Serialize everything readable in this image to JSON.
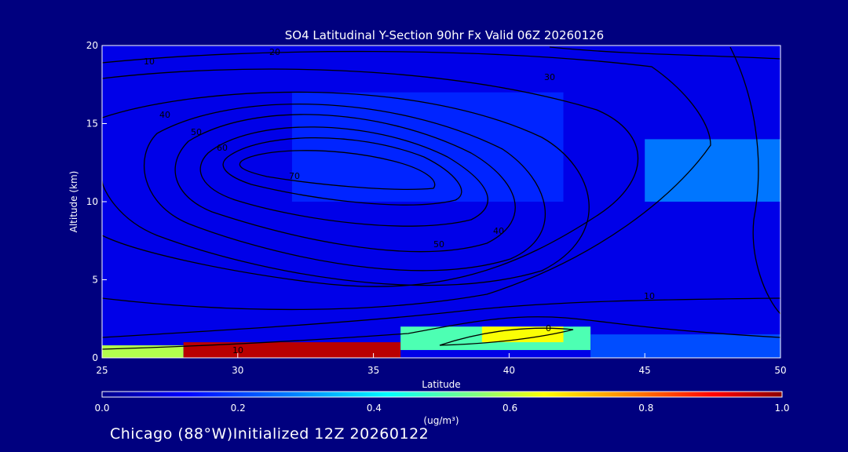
{
  "chart_data": {
    "type": "heatmap",
    "title": "SO4 Latitudinal Y-Section 90hr  Fx Valid 06Z 20260126",
    "xlabel": "Latitude",
    "ylabel": "Altitude (km)",
    "xlim": [
      25,
      50
    ],
    "ylim": [
      0,
      20
    ],
    "x_ticks": [
      25,
      30,
      35,
      40,
      45,
      50
    ],
    "y_ticks": [
      0,
      5,
      10,
      15,
      20
    ],
    "colorbar": {
      "label": "(ug/m³)",
      "min": 0.0,
      "max": 1.0,
      "ticks": [
        "0.0",
        "0.2",
        "0.4",
        "0.6",
        "0.8",
        "1.0"
      ],
      "colors": [
        "#00008b",
        "#0000ff",
        "#0080ff",
        "#00ffff",
        "#80ff80",
        "#ffff00",
        "#ff8000",
        "#ff0000",
        "#8b0000"
      ]
    },
    "field_cells": [
      {
        "lat": [
          25,
          50
        ],
        "alt": [
          0,
          20
        ],
        "value": 0.1
      },
      {
        "lat": [
          32,
          42
        ],
        "alt": [
          10,
          17
        ],
        "value": 0.16
      },
      {
        "lat": [
          45,
          50
        ],
        "alt": [
          10,
          14
        ],
        "value": 0.24
      },
      {
        "lat": [
          25,
          28
        ],
        "alt": [
          0,
          0.8
        ],
        "value": 0.55
      },
      {
        "lat": [
          28,
          36
        ],
        "alt": [
          0,
          1
        ],
        "value": 0.95
      },
      {
        "lat": [
          36,
          43
        ],
        "alt": [
          0.5,
          2
        ],
        "value": 0.45
      },
      {
        "lat": [
          39,
          42
        ],
        "alt": [
          1,
          2
        ],
        "value": 0.62
      },
      {
        "lat": [
          43,
          50
        ],
        "alt": [
          0,
          1.5
        ],
        "value": 0.2
      }
    ],
    "contour_labels": [
      "10",
      "20",
      "30",
      "40",
      "50",
      "60",
      "70",
      "0"
    ],
    "footer": "Chicago (88°W)Initialized 12Z 20260122"
  }
}
